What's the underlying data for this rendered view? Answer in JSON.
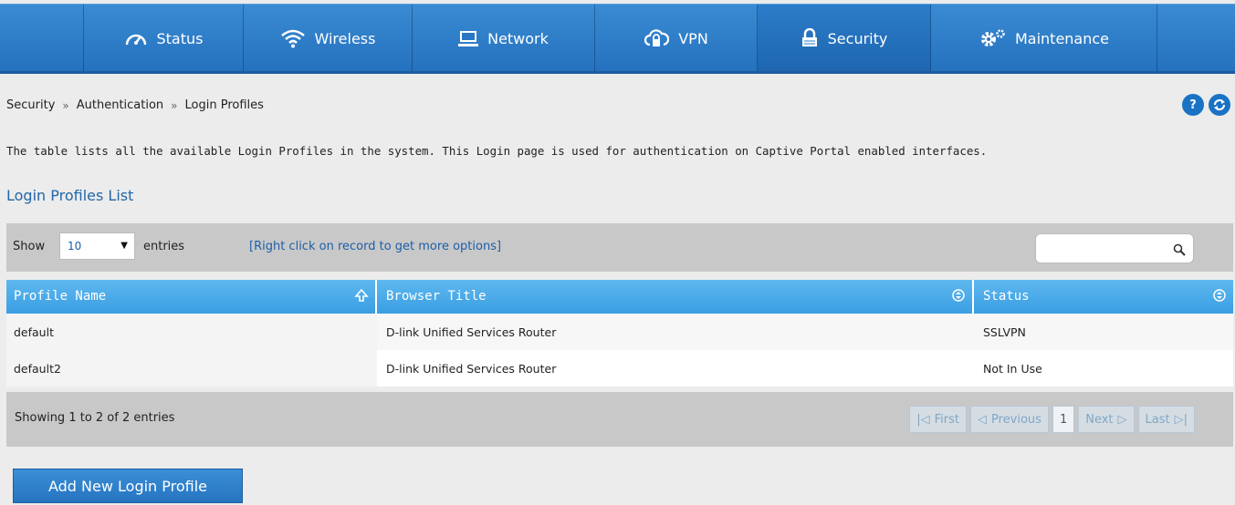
{
  "nav": {
    "items": [
      {
        "label": "Status",
        "icon": "gauge-icon"
      },
      {
        "label": "Wireless",
        "icon": "wifi-icon"
      },
      {
        "label": "Network",
        "icon": "monitor-icon"
      },
      {
        "label": "VPN",
        "icon": "cloud-lock-icon"
      },
      {
        "label": "Security",
        "icon": "lock-icon",
        "active": true
      },
      {
        "label": "Maintenance",
        "icon": "gears-icon"
      }
    ]
  },
  "breadcrumb": {
    "items": [
      "Security",
      "Authentication",
      "Login Profiles"
    ],
    "separator": "»"
  },
  "header_buttons": {
    "help": "?"
  },
  "description": "The table lists all the available Login Profiles in the system. This Login page is used for authentication on Captive Portal enabled interfaces.",
  "section_title": "Login Profiles List",
  "toolbar": {
    "show_label": "Show",
    "entries_value": "10",
    "entries_label": "entries",
    "hint": "[Right click on record to get more options]"
  },
  "table": {
    "columns": [
      "Profile Name",
      "Browser Title",
      "Status"
    ],
    "rows": [
      {
        "profile": "default",
        "browser_title": "D-link Unified Services Router",
        "status": "SSLVPN"
      },
      {
        "profile": "default2",
        "browser_title": "D-link Unified Services Router",
        "status": "Not In Use"
      }
    ]
  },
  "footer": {
    "info": "Showing 1 to 2 of 2 entries",
    "pager": {
      "first": "First",
      "previous": "Previous",
      "current": "1",
      "next": "Next",
      "last": "Last"
    }
  },
  "add_button_label": "Add New Login Profile",
  "colors": {
    "accent": "#2470bd",
    "header": "#3a9ee2"
  }
}
